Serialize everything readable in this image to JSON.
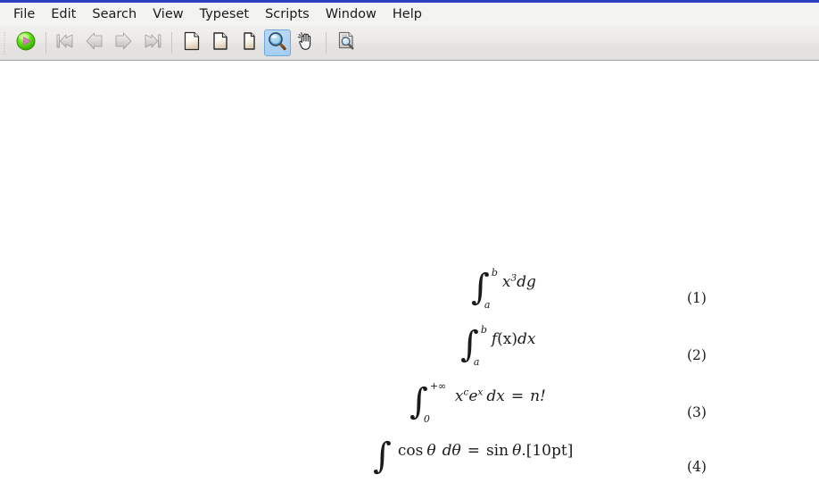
{
  "window": {
    "border_color": "#2b3ec4"
  },
  "menubar": {
    "items": [
      {
        "label": "File",
        "name": "menu-file"
      },
      {
        "label": "Edit",
        "name": "menu-edit"
      },
      {
        "label": "Search",
        "name": "menu-search"
      },
      {
        "label": "View",
        "name": "menu-view"
      },
      {
        "label": "Typeset",
        "name": "menu-typeset"
      },
      {
        "label": "Scripts",
        "name": "menu-scripts"
      },
      {
        "label": "Window",
        "name": "menu-window"
      },
      {
        "label": "Help",
        "name": "menu-help"
      }
    ]
  },
  "toolbar": {
    "buttons": [
      {
        "icon": "typeset-run-icon",
        "selected": false
      },
      {
        "icon": "first-page-icon",
        "selected": false
      },
      {
        "icon": "previous-page-icon",
        "selected": false
      },
      {
        "icon": "next-page-icon",
        "selected": false
      },
      {
        "icon": "last-page-icon",
        "selected": false
      },
      {
        "icon": "fit-to-width-icon",
        "selected": false
      },
      {
        "icon": "fit-to-window-icon",
        "selected": false
      },
      {
        "icon": "actual-size-icon",
        "selected": false
      },
      {
        "icon": "magnify-tool-icon",
        "selected": true
      },
      {
        "icon": "pan-hand-tool-icon",
        "selected": false
      },
      {
        "icon": "search-document-icon",
        "selected": false
      }
    ]
  },
  "document": {
    "equations": [
      {
        "number": "(1)",
        "plain": "∫_a^b x^3 dg",
        "integral_lower": "a",
        "integral_upper": "b",
        "integrand_base": "x",
        "integrand_exponent": "3",
        "differential": "dg",
        "rhs": ""
      },
      {
        "number": "(2)",
        "plain": "∫_a^b f(x)dx",
        "integral_lower": "a",
        "integral_upper": "b",
        "integrand_function": "f",
        "integrand_argument": "(x)",
        "differential": "dx",
        "rhs": ""
      },
      {
        "number": "(3)",
        "plain": "∫_0^{+∞} x^c e^x dx = n!",
        "integral_lower": "0",
        "integral_upper": "+∞",
        "integrand_base": "x",
        "integrand_exponent": "c",
        "integrand_base2": "e",
        "integrand_exponent2": "x",
        "differential": "dx",
        "equals": "=",
        "rhs": "n!"
      },
      {
        "number": "(4)",
        "plain": "∫ cos θ dθ = sin θ.[10pt]",
        "integral_lower": "",
        "integral_upper": "",
        "func_left": "cos",
        "var_left": "θ",
        "differential": "dθ",
        "equals": "=",
        "func_right": "sin",
        "var_right": "θ",
        "trailer": ".[10pt]"
      }
    ]
  }
}
